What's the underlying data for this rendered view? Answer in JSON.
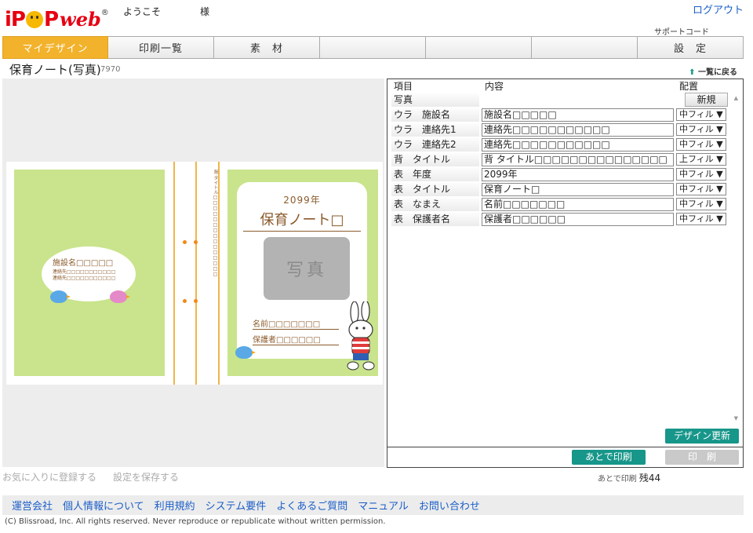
{
  "header": {
    "logo_text": "iP",
    "logo_suffix": "P",
    "logo_web": "web",
    "logo_reg": "®",
    "welcome": "ようこそ",
    "sama": "様",
    "logout": "ログアウト",
    "support_code": "サポートコード"
  },
  "nav": {
    "tabs": [
      {
        "label": "マイデザイン"
      },
      {
        "label": "印刷一覧"
      },
      {
        "label": "素　材"
      },
      {
        "label": ""
      },
      {
        "label": ""
      },
      {
        "label": ""
      },
      {
        "label": "設　定"
      }
    ]
  },
  "page": {
    "title": "保育ノート(写真)",
    "code": "7970",
    "back": "一覧に戻る"
  },
  "preview": {
    "back_name": "施設名□□□□□",
    "back_contact1": "連絡先□□□□□□□□□□□",
    "back_contact2": "連絡先□□□□□□□□□□□",
    "spine_text": "背 タイトル□□□□□□□□□□□□□□□",
    "front_year": "2099年",
    "front_title": "保育ノート□",
    "front_photo": "写真",
    "front_name": "名前□□□□□□□",
    "front_guardian": "保護者□□□□□□"
  },
  "editor": {
    "col_item": "項目",
    "col_content": "内容",
    "col_place": "配置",
    "photo_label": "写真",
    "new_button": "新規",
    "rows": [
      {
        "label": "ウラ　施設名",
        "value": "施設名□□□□□",
        "place": "中フィル ▼"
      },
      {
        "label": "ウラ　連絡先1",
        "value": "連絡先□□□□□□□□□□□",
        "place": "中フィル ▼"
      },
      {
        "label": "ウラ　連絡先2",
        "value": "連絡先□□□□□□□□□□□",
        "place": "中フィル ▼"
      },
      {
        "label": "背　タイトル",
        "value": "背 タイトル□□□□□□□□□□□□□□□",
        "place": "上フィル ▼"
      },
      {
        "label": "表　年度",
        "value": "2099年",
        "place": "中フィル ▼"
      },
      {
        "label": "表　タイトル",
        "value": "保育ノート□",
        "place": "中フィル ▼"
      },
      {
        "label": "表　なまえ",
        "value": "名前□□□□□□□",
        "place": "中フィル ▼"
      },
      {
        "label": "表　保護者名",
        "value": "保護者□□□□□□",
        "place": "中フィル ▼"
      }
    ],
    "update_button": "デザイン更新",
    "later_print_button": "あとで印刷",
    "print_button": "印　刷"
  },
  "status": {
    "later_print_label": "あとで印刷",
    "remaining": "残44"
  },
  "actions": {
    "favorite": "お気に入りに登録する",
    "save_settings": "設定を保存する"
  },
  "footer": {
    "links": [
      "運営会社",
      "個人情報について",
      "利用規約",
      "システム要件",
      "よくあるご質問",
      "マニュアル",
      "お問い合わせ"
    ],
    "copyright": "(C) Blissroad, Inc. All rights reserved. Never reproduce or republicate without written permission."
  },
  "colors": {
    "accent": "#f2b22b",
    "teal": "#17968a",
    "link": "#1b5ec8",
    "logo_red": "#e60012",
    "page_green": "#c9e48c"
  }
}
